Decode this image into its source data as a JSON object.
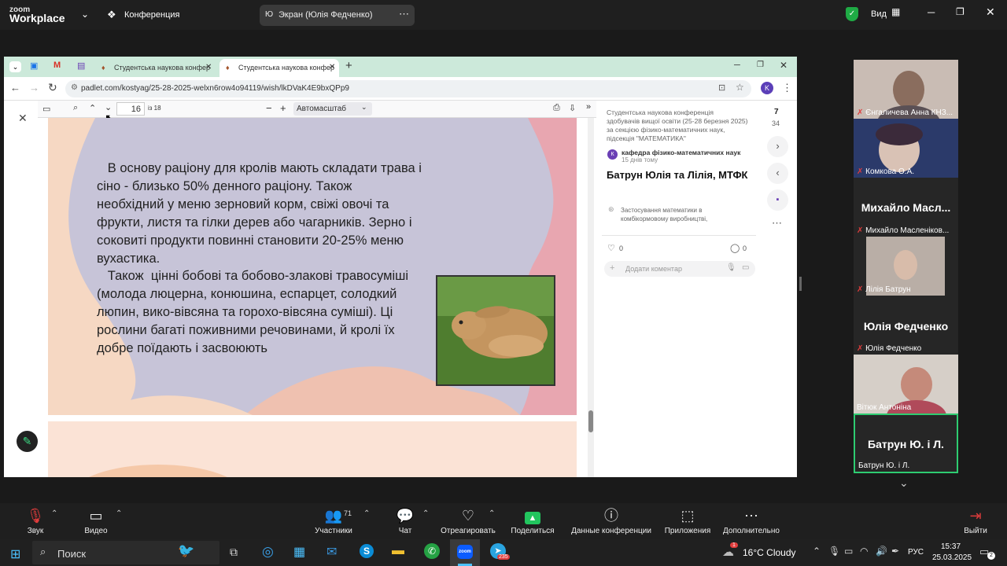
{
  "zoom": {
    "logo_line1": "zoom",
    "logo_line2": "Workplace",
    "conference_label": "Конференция",
    "share_avatar": "Ю",
    "share_label": "Экран (Юлія Федченко)",
    "view_label": "Вид"
  },
  "browser": {
    "tabs": [
      {
        "label": "Студентська наукова конфер"
      },
      {
        "label": "Студентська наукова конфер"
      }
    ],
    "url": "padlet.com/kostyag/25-28-2025-welxn6row4o94119/wish/lkDVaK4E9bxQPp9",
    "profile_letter": "K"
  },
  "pdf": {
    "page_current": "16",
    "page_total": "із 18",
    "zoom_select": "Автомасштаб"
  },
  "slide": {
    "paragraph1": [
      "   В основу раціону для кролів мають складати трава і",
      "сіно - близько 50% денного раціону. Також",
      "необхідний у меню зерновий корм, свіжі овочі та",
      "фрукти, листя та гілки дерев або чагарників. Зерно і",
      "соковиті продукти повинні становити 20-25% меню",
      "вухастика."
    ],
    "paragraph2": [
      "   Також  цінні бобові та бобово-злакові травосуміші",
      "(молода люцерна, конюшина, еспарцет, солодкий",
      "люпин, вико-вівсяна та горохо-вівсяна суміші). Ці",
      "рослини багаті поживними речовинами, й кролі їх",
      "добре поїдають і засвоюють"
    ]
  },
  "post": {
    "board_title": "Студентська наукова конференція здобувачів вищої освіти (25-28 березня 2025) за секцією фізико-математичних наук, підсекція \"МАТЕМАТИКА\"",
    "author_avatar": "К",
    "author": "кафедра фізико-математичних наук",
    "time": "15 днів тому",
    "title": "Батрун Юлія та Лілія, МТФК",
    "attachment": "Застосування математики в комбікормовому виробництві,",
    "likes": "0",
    "comments": "0",
    "comment_placeholder": "Додати коментар",
    "counter_current": "7",
    "counter_total": "34"
  },
  "participants": [
    {
      "name": "Єнгаличева Анна КНЗ..."
    },
    {
      "name": "Комкова О.А."
    },
    {
      "big": "Михайло  Масл...",
      "name": "Михайло Масленіков..."
    },
    {
      "name": "Лілія Батрун"
    },
    {
      "big": "Юлія Федченко",
      "name": "Юлія Федченко"
    },
    {
      "name": "Вітюк Антоніна"
    },
    {
      "big": "Батрун Ю. і Л.",
      "name": "Батрун Ю. і Л."
    }
  ],
  "toolbar": {
    "audio": "Звук",
    "video": "Видео",
    "participants": "Участники",
    "participants_count": "71",
    "chat": "Чат",
    "react": "Отреагировать",
    "share": "Поделиться",
    "info": "Данные конференции",
    "apps": "Приложения",
    "more": "Дополнительно",
    "leave": "Выйти"
  },
  "taskbar": {
    "search": "Поиск",
    "weather": "16°C  Cloudy",
    "lang": "РУС",
    "time": "15:37",
    "date": "25.03.2025",
    "notif_count": "2",
    "telegram_badge": "235",
    "weather_badge": "1"
  },
  "colors": {
    "accent_green": "#2ecc71",
    "zoom_blue": "#0b5cff",
    "slide_lilac": "#c7c4d8",
    "slide_pink": "#e8a6b0",
    "slide_peach": "#f7d9c4"
  }
}
